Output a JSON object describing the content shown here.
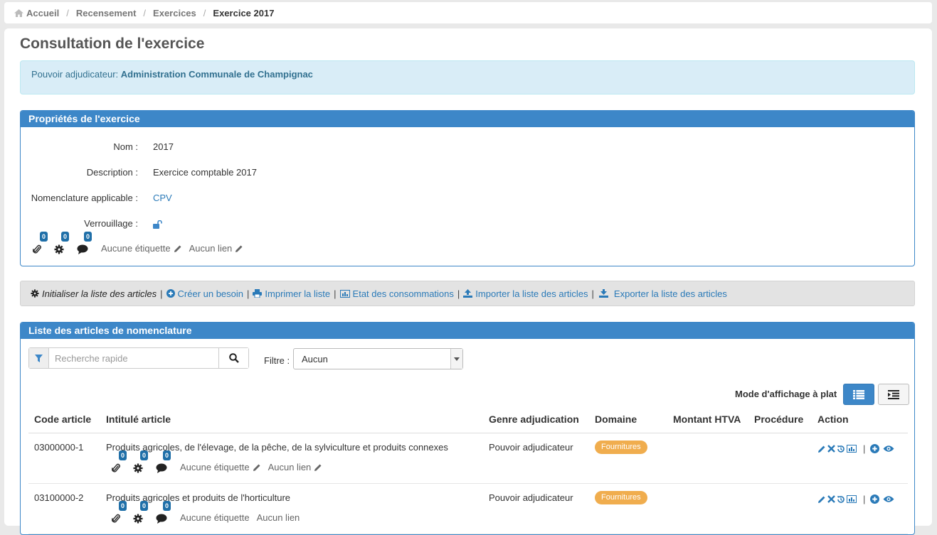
{
  "breadcrumb": {
    "items": [
      "Accueil",
      "Recensement",
      "Exercices"
    ],
    "current": "Exercice 2017"
  },
  "page": {
    "title": "Consultation de l'exercice"
  },
  "info": {
    "label": "Pouvoir adjudicateur:",
    "value": "Administration Communale de Champignac"
  },
  "properties": {
    "title": "Propriétés de l'exercice",
    "fields": [
      {
        "label": "Nom :",
        "value": "2017"
      },
      {
        "label": "Description :",
        "value": "Exercice comptable 2017"
      },
      {
        "label": "Nomenclature applicable :",
        "value": "CPV"
      },
      {
        "label": "Verrouillage :"
      }
    ],
    "attachments_count": "0",
    "settings_count": "0",
    "comments_count": "0",
    "no_tag": "Aucune étiquette",
    "no_link": "Aucun lien"
  },
  "toolbar": {
    "init": "Initialiser la liste des articles",
    "create": "Créer un besoin",
    "print": "Imprimer la liste",
    "consumption": "Etat des consommations",
    "import": "Importer la liste des articles",
    "export": "Exporter la liste des articles"
  },
  "list": {
    "title": "Liste des articles de nomenclature",
    "search_placeholder": "Recherche rapide",
    "filter_label": "Filtre :",
    "filter_value": "Aucun",
    "mode_label": "Mode d'affichage à plat",
    "columns": [
      "Code article",
      "Intitulé article",
      "Genre adjudication",
      "Domaine",
      "Montant HTVA",
      "Procédure",
      "Action"
    ],
    "rows": [
      {
        "code": "03000000-1",
        "title": "Produits agricoles, de l'élevage, de la pêche, de la sylviculture et produits connexes",
        "genre": "Pouvoir adjudicateur",
        "domaine": "Fournitures",
        "attachments": "0",
        "settings": "0",
        "comments": "0",
        "no_tag": "Aucune étiquette",
        "no_link": "Aucun lien"
      },
      {
        "code": "03100000-2",
        "title": "Produits agricoles et produits de l'horticulture",
        "genre": "Pouvoir adjudicateur",
        "domaine": "Fournitures",
        "attachments": "0",
        "settings": "0",
        "comments": "0",
        "no_tag": "Aucune étiquette",
        "no_link": "Aucun lien"
      }
    ]
  },
  "colors": {
    "primary": "#3d87c8",
    "link": "#2a7ab8",
    "badge": "#1f6fa8",
    "warning": "#f0ad4e",
    "info_bg": "#d9edf7"
  }
}
